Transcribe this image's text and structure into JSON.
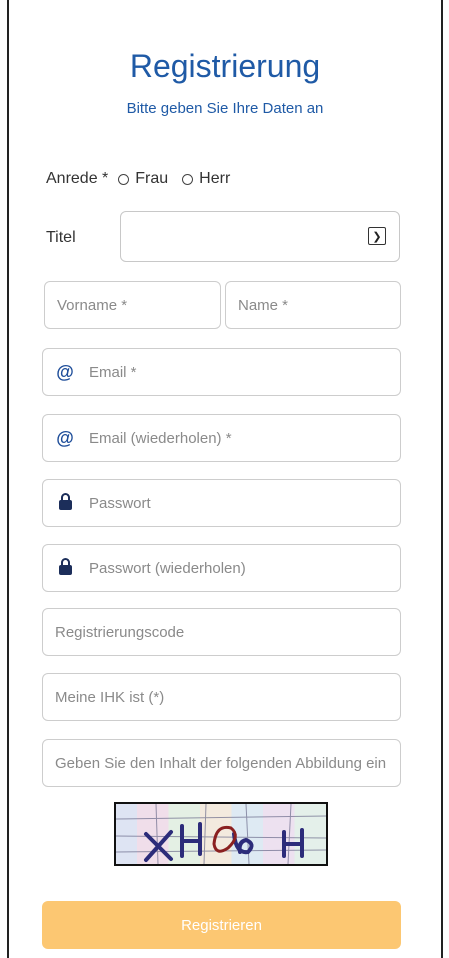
{
  "header": {
    "title": "Registrierung",
    "subtitle": "Bitte geben Sie Ihre Daten an"
  },
  "anrede": {
    "label": "Anrede *",
    "options": [
      "Frau",
      "Herr"
    ]
  },
  "titel": {
    "label": "Titel",
    "selected": ""
  },
  "fields": {
    "vorname": "Vorname *",
    "name": "Name *",
    "email": "Email *",
    "email_repeat": "Email (wiederholen) *",
    "passwort": "Passwort",
    "passwort_repeat": "Passwort (wiederholen)",
    "registrierungscode": "Registrierungscode",
    "ihk": "Meine IHK ist (*)",
    "captcha_input": "Geben Sie den Inhalt der folgenden Abbildung ein"
  },
  "icons": {
    "email": "at-icon",
    "password": "lock-icon",
    "select": "chevron-down-icon"
  },
  "button": {
    "label": "Registrieren",
    "color": "#fcc772"
  },
  "colors": {
    "accent": "#1f5aa6"
  }
}
